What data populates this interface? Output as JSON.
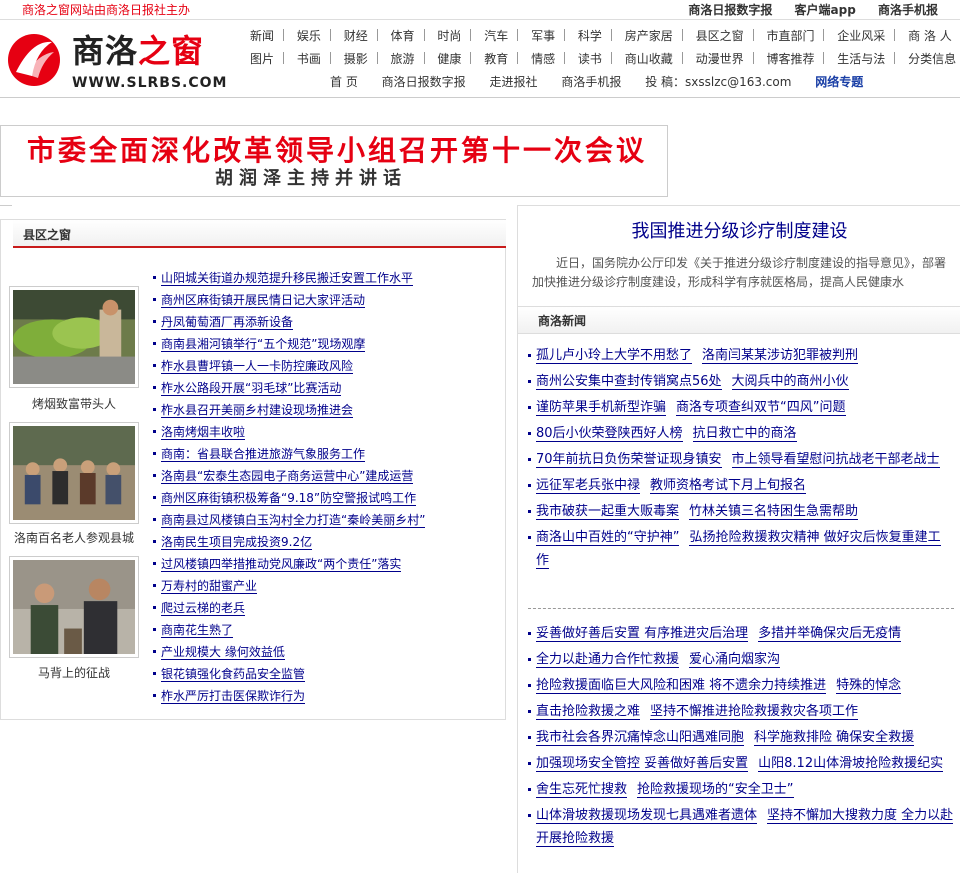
{
  "topbar": {
    "note": "商洛之窗网站由商洛日报社主办",
    "links": [
      "商洛日报数字报",
      "客户端app",
      "商洛手机报"
    ]
  },
  "logo": {
    "cn_main": "商洛",
    "cn_accent": "之窗",
    "en": "WWW.SLRBS.COM"
  },
  "nav": {
    "row1": [
      "新闻",
      "娱乐",
      "财经",
      "体育",
      "时尚",
      "汽车",
      "军事",
      "科学",
      "房产家居",
      "县区之窗",
      "市直部门",
      "企业风采",
      "商 洛 人"
    ],
    "row2": [
      "图片",
      "书画",
      "摄影",
      "旅游",
      "健康",
      "教育",
      "情感",
      "读书",
      "商山收藏",
      "动漫世界",
      "博客推荐",
      "生活与法",
      "分类信息"
    ],
    "row3": [
      "首 页",
      "商洛日报数字报",
      "走进报社",
      "商洛手机报",
      "投 稿：sxsslzc@163.com"
    ],
    "row3_special": "网络专题"
  },
  "banner": {
    "headline": "市委全面深化改革领导小组召开第十一次会议",
    "subline": "胡润泽主持并讲话"
  },
  "county": {
    "title": "县区之窗",
    "photos": [
      {
        "caption": "烤烟致富带头人",
        "icon": "tobacco-harvest-photo"
      },
      {
        "caption": "洛南百名老人参观县城",
        "icon": "elders-visit-photo"
      },
      {
        "caption": "马背上的征战",
        "icon": "two-men-talking-photo"
      }
    ],
    "items": [
      "山阳城关街道办规范提升移民搬迁安置工作水平",
      "商州区麻街镇开展民情日记大家评活动",
      "丹凤葡萄酒厂再添新设备",
      "商南县湘河镇举行“五个规范”现场观摩",
      "柞水县曹坪镇一人一卡防控廉政风险",
      "柞水公路段开展“羽毛球”比赛活动",
      "柞水县召开美丽乡村建设现场推进会",
      "洛南烤烟丰收啦",
      "商南：省县联合推进旅游气象服务工作",
      "洛南县“宏泰生态园电子商务运营中心”建成运营",
      "商州区麻街镇积极筹备“9.18”防空警报试鸣工作",
      "商南县过风楼镇白玉沟村全力打造“秦岭美丽乡村”",
      "洛南民生项目完成投资9.2亿",
      "过风楼镇四举措推动党风廉政“两个责任”落实",
      "万寿村的甜蜜产业",
      "爬过云梯的老兵",
      "商南花生熟了",
      "产业规模大 缘何效益低",
      "银花镇强化食药品安全监管",
      "柞水严厉打击医保欺诈行为"
    ]
  },
  "feature": {
    "title": "我国推进分级诊疗制度建设",
    "summary": "近日，国务院办公厅印发《关于推进分级诊疗制度建设的指导意见》，部署加快推进分级诊疗制度建设，形成科学有序就医格局，提高人民健康水"
  },
  "news": {
    "title": "商洛新闻",
    "group1": [
      [
        "孤儿卢小玲上大学不用愁了",
        "洛南闫某某涉访犯罪被判刑"
      ],
      [
        "商州公安集中查封传销窝点56处",
        "大阅兵中的商州小伙"
      ],
      [
        "谨防苹果手机新型诈骗",
        "商洛专项查纠双节“四风”问题"
      ],
      [
        "80后小伙荣登陕西好人榜",
        "抗日救亡中的商洛"
      ],
      [
        "70年前抗日负伤荣誉证现身镇安",
        "市上领导看望慰问抗战老干部老战士"
      ],
      [
        "远征军老兵张中禄",
        "教师资格考试下月上旬报名"
      ],
      [
        "我市破获一起重大贩毒案",
        "竹林关镇三名特困生急需帮助"
      ],
      [
        "商洛山中百姓的“守护神”",
        "弘扬抢险救援救灾精神 做好灾后恢复重建工作"
      ]
    ],
    "group2": [
      [
        "妥善做好善后安置 有序推进灾后治理",
        "多措并举确保灾后无疫情"
      ],
      [
        "全力以赴通力合作忙救援",
        "爱心涌向烟家沟"
      ],
      [
        "抢险救援面临巨大风险和困难 将不遗余力持续推进",
        "特殊的悼念"
      ],
      [
        "直击抢险救援之难",
        "坚持不懈推进抢险救援救灾各项工作"
      ],
      [
        "我市社会各界沉痛悼念山阳遇难同胞",
        "科学施救排险 确保安全救援"
      ],
      [
        "加强现场安全管控 妥善做好善后安置",
        "山阳8.12山体滑坡抢险救援纪实"
      ],
      [
        "舍生忘死忙搜救",
        "抢险救援现场的“安全卫士”"
      ],
      [
        "山体滑坡救援现场发现七具遇难者遗体",
        "坚持不懈加大搜救力度 全力以赴开展抢险救援"
      ]
    ]
  },
  "colors": {
    "accent_red": "#e60012",
    "link_blue": "#00008b",
    "rail_red": "#c81b1b"
  }
}
